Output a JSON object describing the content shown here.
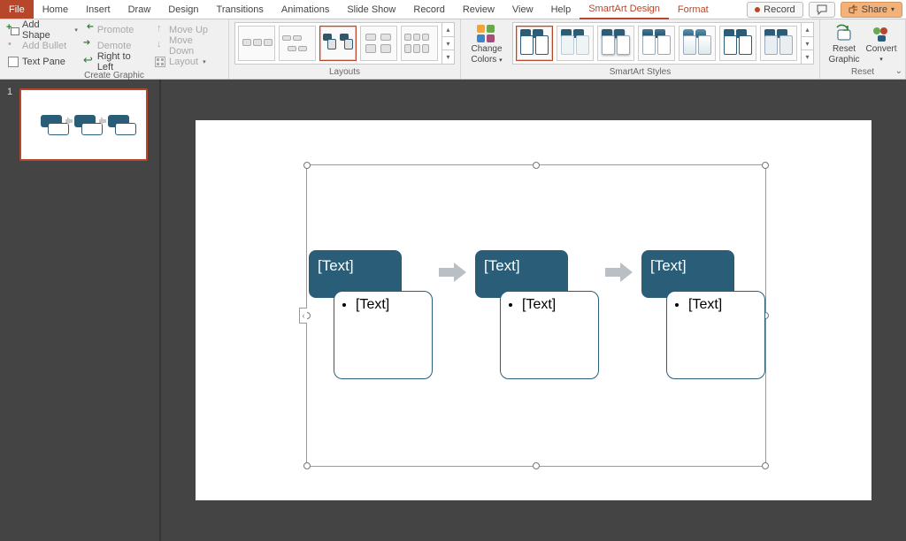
{
  "tabs": {
    "file": "File",
    "items": [
      "Home",
      "Insert",
      "Draw",
      "Design",
      "Transitions",
      "Animations",
      "Slide Show",
      "Record",
      "Review",
      "View",
      "Help"
    ],
    "context": [
      "SmartArt Design",
      "Format"
    ],
    "active": "SmartArt Design"
  },
  "titlebar": {
    "record": "Record",
    "share": "Share"
  },
  "ribbon": {
    "create_graphic": {
      "label": "Create Graphic",
      "add_shape": "Add Shape",
      "add_bullet": "Add Bullet",
      "text_pane": "Text Pane",
      "promote": "Promote",
      "demote": "Demote",
      "right_to_left": "Right to Left",
      "move_up": "Move Up",
      "move_down": "Move Down",
      "layout": "Layout"
    },
    "layouts": {
      "label": "Layouts"
    },
    "change_colors": {
      "label_l1": "Change",
      "label_l2": "Colors"
    },
    "styles": {
      "label": "SmartArt Styles"
    },
    "reset": {
      "label": "Reset",
      "reset_graphic_l1": "Reset",
      "reset_graphic_l2": "Graphic",
      "convert": "Convert"
    }
  },
  "thumb": {
    "index": "1"
  },
  "smartart": {
    "blocks": [
      {
        "header": "[Text]",
        "bullet": "[Text]"
      },
      {
        "header": "[Text]",
        "bullet": "[Text]"
      },
      {
        "header": "[Text]",
        "bullet": "[Text]"
      }
    ]
  },
  "colors": {
    "accent": "#2a5d78",
    "pp_orange": "#b7472a",
    "arrow_gray": "#b9bfc4"
  }
}
